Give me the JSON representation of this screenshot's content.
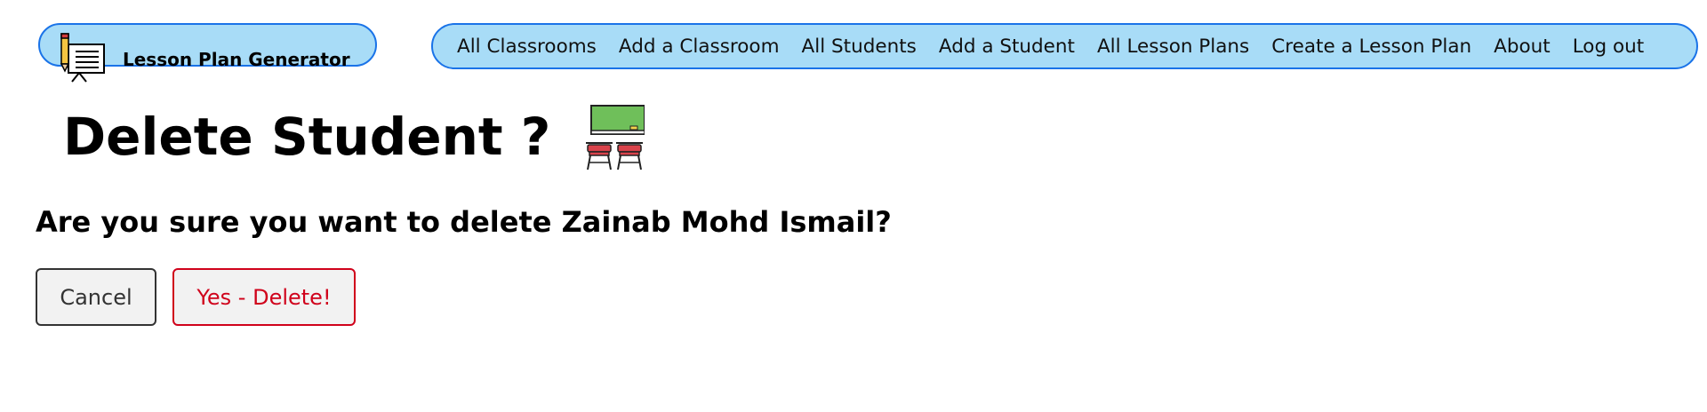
{
  "header": {
    "brand": {
      "title": "Lesson Plan Generator",
      "icon": "lesson-plan-easel-icon"
    },
    "nav": [
      "All Classrooms",
      "Add a Classroom",
      "All Students",
      "Add a Student",
      "All Lesson Plans",
      "Create a Lesson Plan",
      "About",
      "Log out"
    ]
  },
  "main": {
    "title": "Delete Student ?",
    "title_icon": "classroom-desks-icon",
    "confirm_message": "Are you sure you want to delete Zainab Mohd Ismail?",
    "cancel_label": "Cancel",
    "delete_label": "Yes - Delete!"
  },
  "colors": {
    "nav_background": "#a8dcf7",
    "nav_border": "#1a73e8",
    "delete_accent": "#d0021b",
    "button_background": "#f2f2f2"
  }
}
